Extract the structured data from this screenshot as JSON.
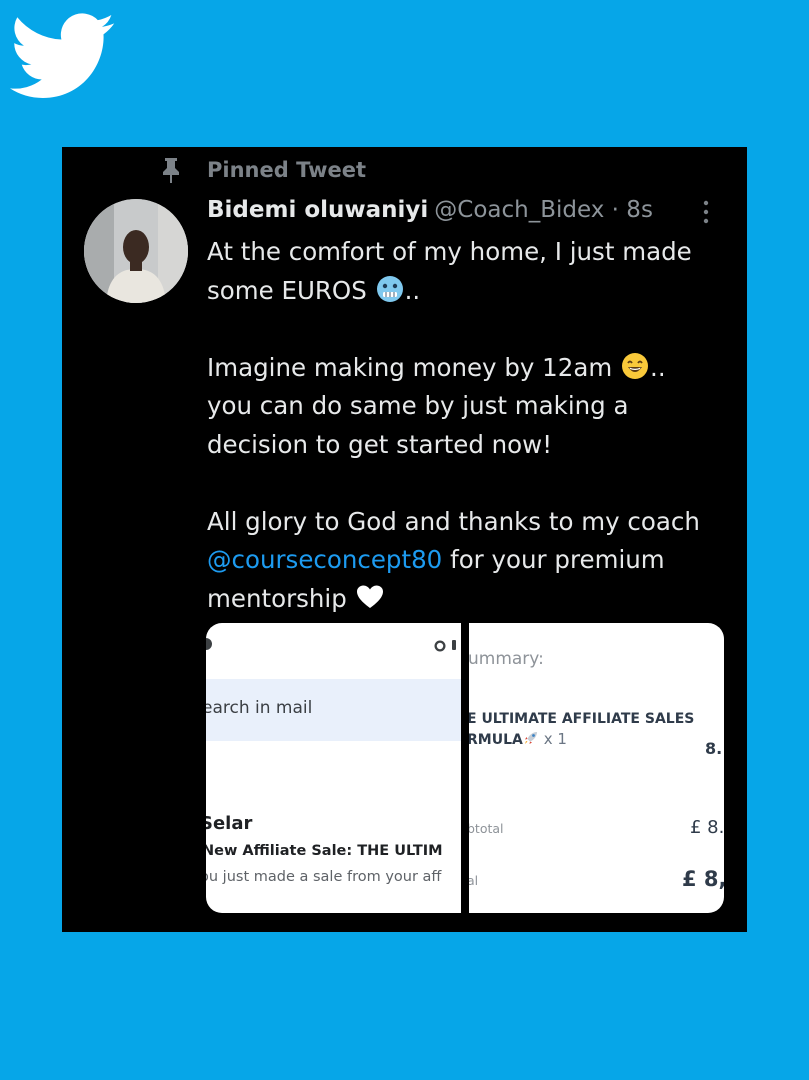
{
  "brand": {
    "logo_icon": "twitter-bird-icon",
    "background_color": "#06a6e8"
  },
  "tweet": {
    "pinned_label": "Pinned Tweet",
    "author_name": "Bidemi oluwaniyi",
    "handle_time": "@Coach_Bidex · 8s",
    "line1": "At the comfort of my home, I just made",
    "line2_text": "some EUROS",
    "line2_tail": "..",
    "line3_text": "Imagine making money by 12am",
    "line3_tail": "..",
    "line4": "you can do same by just making a",
    "line5": "decision to get started now!",
    "line6": "All glory to God and thanks to my coach",
    "mention": "@courseconcept80",
    "line7_tail": "for your premium",
    "line8_text": "mentorship",
    "emoji_icons": [
      "cold-face-emoji-icon",
      "grinning-emoji-icon",
      "white-heart-emoji-icon"
    ]
  },
  "media": {
    "left": {
      "search_placeholder": "earch in mail",
      "sender": "Selar",
      "subject": "New Affiliate Sale: THE ULTIM",
      "snippet": "ou just made a sale from your aff"
    },
    "right": {
      "summary_label": "ummary:",
      "product_line1": "E ULTIMATE AFFILIATE SALES",
      "product_line2": "RMULA",
      "quantity": "x 1",
      "price": "8.",
      "subtotal_label": "btotal",
      "subtotal_value": "£ 8.",
      "total_label": "al",
      "total_value": "£ 8,8"
    }
  }
}
